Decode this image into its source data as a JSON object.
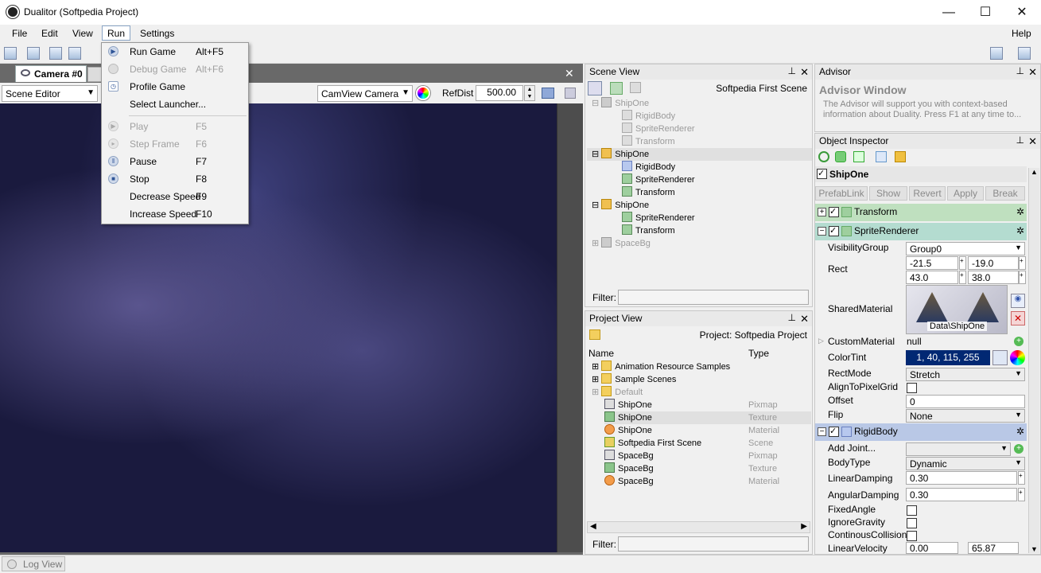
{
  "window": {
    "title": "Dualitor (Softpedia Project)",
    "minimize": "—",
    "maximize": "☐",
    "close": "✕"
  },
  "menubar": {
    "items": [
      "File",
      "Edit",
      "View",
      "Run",
      "Settings"
    ],
    "help": "Help"
  },
  "run_menu": {
    "items": [
      {
        "label": "Run Game",
        "shortcut": "Alt+F5",
        "enabled": true
      },
      {
        "label": "Debug Game",
        "shortcut": "Alt+F6",
        "enabled": false
      },
      {
        "label": "Profile Game",
        "shortcut": "",
        "enabled": true
      },
      {
        "label": "Select Launcher...",
        "shortcut": "",
        "enabled": true
      },
      {
        "label": "Play",
        "shortcut": "F5",
        "enabled": false
      },
      {
        "label": "Step Frame",
        "shortcut": "F6",
        "enabled": false
      },
      {
        "label": "Pause",
        "shortcut": "F7",
        "enabled": true
      },
      {
        "label": "Stop",
        "shortcut": "F8",
        "enabled": true
      },
      {
        "label": "Decrease Speed",
        "shortcut": "F9",
        "enabled": true
      },
      {
        "label": "Increase Speed",
        "shortcut": "F10",
        "enabled": true
      }
    ]
  },
  "document": {
    "tab_label": "Camera #0",
    "close": "✕",
    "mode_combo": "Scene Editor",
    "camera_combo": "CamView Camera",
    "refdist_label": "RefDist",
    "refdist_value": "500.00"
  },
  "scene_view": {
    "title": "Scene View",
    "scene_name": "Softpedia First Scene",
    "nodes": [
      {
        "label": "ShipOne",
        "type": "obj",
        "active": false
      },
      {
        "label": "RigidBody",
        "type": "cmp",
        "active": false
      },
      {
        "label": "SpriteRenderer",
        "type": "cmp",
        "active": false
      },
      {
        "label": "Transform",
        "type": "cmp",
        "active": false
      },
      {
        "label": "ShipOne",
        "type": "obj",
        "active": true
      },
      {
        "label": "RigidBody",
        "type": "body",
        "active": true
      },
      {
        "label": "SpriteRenderer",
        "type": "cmp",
        "active": true
      },
      {
        "label": "Transform",
        "type": "cmp",
        "active": true
      },
      {
        "label": "ShipOne",
        "type": "obj",
        "active": true
      },
      {
        "label": "SpriteRenderer",
        "type": "cmp",
        "active": true
      },
      {
        "label": "Transform",
        "type": "cmp",
        "active": true
      },
      {
        "label": "SpaceBg",
        "type": "obj",
        "active": false
      }
    ],
    "filter_label": "Filter:"
  },
  "project_view": {
    "title": "Project View",
    "project_name": "Project: Softpedia Project",
    "col_name": "Name",
    "col_type": "Type",
    "rows": [
      {
        "name": "Animation Resource Samples",
        "type": "",
        "icon": "fold"
      },
      {
        "name": "Sample Scenes",
        "type": "",
        "icon": "fold"
      },
      {
        "name": "Default",
        "type": "",
        "icon": "fold"
      },
      {
        "name": "ShipOne",
        "type": "Pixmap",
        "icon": "pix"
      },
      {
        "name": "ShipOne",
        "type": "Texture",
        "icon": "tex"
      },
      {
        "name": "ShipOne",
        "type": "Material",
        "icon": "mat"
      },
      {
        "name": "Softpedia First Scene",
        "type": "Scene",
        "icon": "scn"
      },
      {
        "name": "SpaceBg",
        "type": "Pixmap",
        "icon": "pix"
      },
      {
        "name": "SpaceBg",
        "type": "Texture",
        "icon": "tex"
      },
      {
        "name": "SpaceBg",
        "type": "Material",
        "icon": "mat"
      }
    ],
    "filter_label": "Filter:"
  },
  "advisor": {
    "title": "Advisor",
    "heading": "Advisor Window",
    "text": "The Advisor will support you with context-based information about Duality. Press F1 at any time to..."
  },
  "inspector": {
    "title": "Object Inspector",
    "object_name": "ShipOne",
    "prefab_buttons": [
      "PrefabLink",
      "Show",
      "Revert",
      "Apply",
      "Break"
    ],
    "transform_label": "Transform",
    "sprite_label": "SpriteRenderer",
    "visibility_label": "VisibilityGroup",
    "visibility_value": "Group0",
    "rect_label": "Rect",
    "rect_x": "-21.5",
    "rect_y": "-19.0",
    "rect_w": "43.0",
    "rect_h": "38.0",
    "material_label": "SharedMaterial",
    "material_value": "Data\\ShipOne",
    "custom_material_label": "CustomMaterial",
    "custom_material_value": "null",
    "colortint_label": "ColorTint",
    "colortint_value": "1, 40, 115, 255",
    "colortint_color": "#012873",
    "rectmode_label": "RectMode",
    "rectmode_value": "Stretch",
    "align_label": "AlignToPixelGrid",
    "offset_label": "Offset",
    "offset_value": "0",
    "flip_label": "Flip",
    "flip_value": "None",
    "rigidbody_label": "RigidBody",
    "addjoint_label": "Add Joint...",
    "bodytype_label": "BodyType",
    "bodytype_value": "Dynamic",
    "lineardamp_label": "LinearDamping",
    "lineardamp_value": "0.30",
    "angulardamp_label": "AngularDamping",
    "angulardamp_value": "0.30",
    "fixedangle_label": "FixedAngle",
    "ignoregravity_label": "IgnoreGravity",
    "continuous_label": "ContinousCollision",
    "linearvel_label": "LinearVelocity",
    "linearvel_x": "0.00",
    "linearvel_y": "65.87"
  },
  "status": {
    "log_view": "Log View"
  },
  "colors": {
    "accent_green": "#bfe0bf",
    "accent_teal": "#b4dcd0",
    "accent_blue": "#b9c8e6"
  }
}
